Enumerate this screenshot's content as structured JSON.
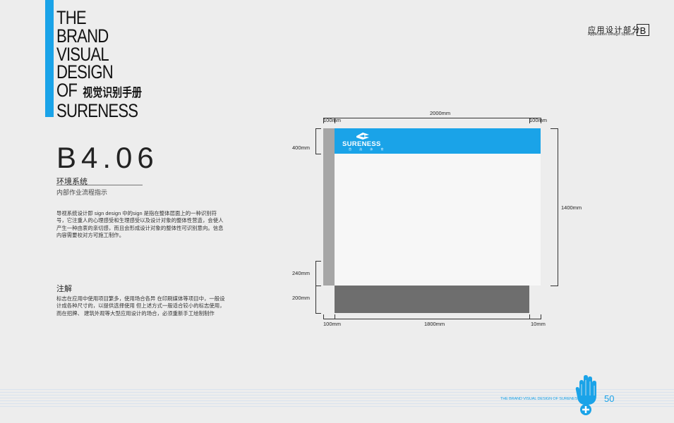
{
  "title": {
    "lines": [
      "THE",
      "BRAND",
      "VISUAL",
      "DESIGN",
      "OF",
      "SURENESS"
    ],
    "chinese": "视觉识别手册"
  },
  "header": {
    "chinese": "应用设计部分",
    "english": "Application Design System",
    "section_letter": "B"
  },
  "section": {
    "code": "B4.06",
    "title": "环境系统",
    "subtitle": "内部作业流程指示"
  },
  "body_text": "导视系统设计即 sign design 中的sign 是指在整体层面上的一种识别符号，它注重人的心理感受和生理感受以及设计对象的整体性营造，会使人产生一种由衷的亲切感，而且会形成设计对象的整体性可识别意向。信息内容需要校对方可施工制作。",
  "note": {
    "heading": "注解",
    "text": "标志在应用中使用项目繁多，使用场合各异  在印刷媒体等项目中，一般设计成各种尺寸的，以提供选择使用  但上述方式一般适合较小的标志使用，而在招牌、  建筑外观等大型应用设计的场合，必须重新手工绘制制作"
  },
  "drawing": {
    "dims": {
      "top_total": "2000mm",
      "top_left": "100mm",
      "top_right": "100mm",
      "left_header": "400mm",
      "left_lower": "240mm",
      "left_base": "200mm",
      "right_total": "1400mm",
      "bottom_left": "100mm",
      "bottom_mid": "1800mm",
      "bottom_right": "10mm"
    },
    "logo": {
      "name": "SURENESS",
      "sub": "首 选 体 育"
    },
    "colors": {
      "brand_blue": "#1aa3e8",
      "post_gray": "#a6a6a6",
      "base_gray": "#6e6e6e",
      "board": "#f7f7f7"
    }
  },
  "footer": {
    "text": "THE BRAND VISUAL DESIGN OF SURENESS",
    "page_number": "50",
    "icon": "hand-plus-icon"
  }
}
